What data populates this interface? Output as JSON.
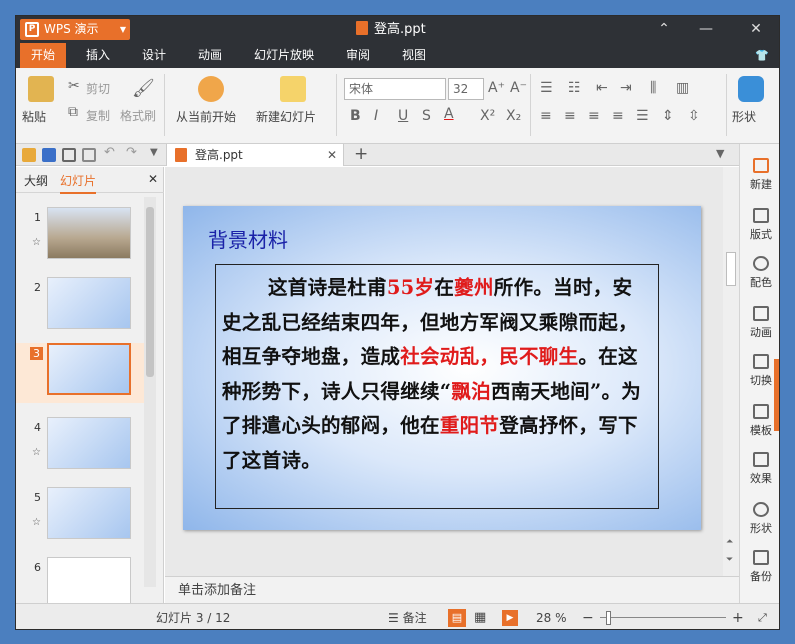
{
  "window": {
    "app_button": "WPS 演示",
    "app_logo": "P",
    "title": "登高.ppt",
    "controls": [
      "⌃",
      "—",
      "✕"
    ]
  },
  "menu": [
    "开始",
    "插入",
    "设计",
    "动画",
    "幻灯片放映",
    "审阅",
    "视图"
  ],
  "ribbon": {
    "paste": "粘贴",
    "cut": "剪切",
    "copy": "复制",
    "format_painter": "格式刷",
    "from_current": "从当前开始",
    "new_slide": "新建幻灯片",
    "font_name": "宋体",
    "font_size": "32",
    "shape": "形状"
  },
  "tabs": {
    "doc_tab": "登高.ppt",
    "add": "+"
  },
  "panel": {
    "tab_outline": "大纲",
    "tab_slides": "幻灯片",
    "close": "✕",
    "thumbnails": [
      "1",
      "2",
      "3",
      "4",
      "5",
      "6"
    ]
  },
  "slide": {
    "title": "背景材料",
    "p1": "这首诗是杜甫",
    "r1": "55岁",
    "p2": "在",
    "r2": "夔州",
    "p3": "所作。当时，安史之乱已经结束四年，但地方军阀又乘隙而起，相互争夺地盘，造成",
    "r3": "社会动乱，民不聊生",
    "p4": "。在这种形势下，诗人只得继续“",
    "r4": "飘泊",
    "p5": "西南天地间”。为了排遣心头的郁闷，他在",
    "r5": "重阳节",
    "p6": "登高抒怀，写下了这首诗。"
  },
  "notes_placeholder": "单击添加备注",
  "right_toolbar": [
    "新建",
    "版式",
    "配色",
    "动画",
    "切换",
    "模板",
    "效果",
    "形状",
    "备份"
  ],
  "status": {
    "slide_counter": "幻灯片 3 / 12",
    "notes": "备注",
    "zoom": "28 %",
    "minus": "−",
    "plus": "+"
  },
  "colors": {
    "accent": "#e8702a",
    "title_blue": "#1a22a8",
    "highlight_red": "#e01b1b",
    "titlebar": "#2e3136"
  }
}
